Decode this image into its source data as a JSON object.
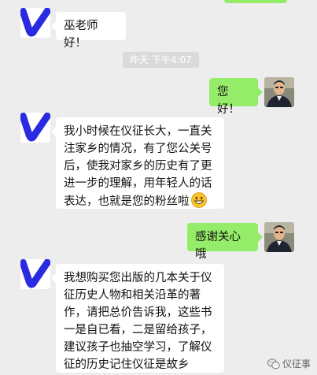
{
  "messages": [
    {
      "id": "m1",
      "side": "received",
      "text": "巫老师好！"
    },
    {
      "id": "m2",
      "side": "sent",
      "text": "您好！"
    },
    {
      "id": "m3",
      "side": "received",
      "text": "我小时候在仪征长大，一直关注家乡的情况，有了您公关号后，使我对家乡的历史有了更进一步的理解，用年轻人的话表达，也就是您的粉丝啦"
    },
    {
      "id": "m4",
      "side": "sent",
      "text": "感谢关心哦"
    },
    {
      "id": "m5",
      "side": "received",
      "text": "我想购买您出版的几本关于仪征历史人物和相关沿革的著作，请把总价告诉我，这些书一是自已看，二是留给孩子，建议孩子也抽空学习，了解仪征的历史记住仪征是故乡"
    }
  ],
  "timestamp": "昨天 下午4:07",
  "watermark": "仪征事",
  "colors": {
    "background": "#ededed",
    "sent_bubble": "#95ec69",
    "received_bubble": "#ffffff",
    "timestamp_bg": "#dadada"
  },
  "icons": {
    "emoji": "grinning-face-icon",
    "watermark": "wechat-icon",
    "sender_avatar": "blue-v-avatar",
    "self_avatar": "man-portrait-avatar"
  }
}
